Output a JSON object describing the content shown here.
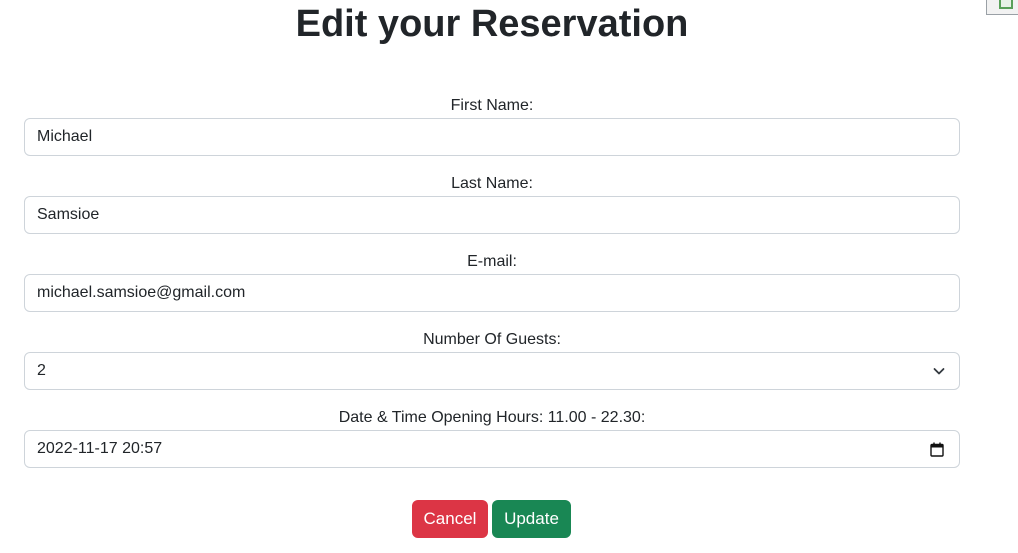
{
  "page": {
    "title": "Edit your Reservation"
  },
  "form": {
    "first_name": {
      "label": "First Name:",
      "value": "Michael"
    },
    "last_name": {
      "label": "Last Name:",
      "value": "Samsioe"
    },
    "email": {
      "label": "E-mail:",
      "value": "michael.samsioe@gmail.com"
    },
    "guests": {
      "label": "Number Of Guests:",
      "value": "2",
      "icon": "chevron-down-icon"
    },
    "datetime": {
      "label": "Date & Time Opening Hours: 11.00 - 22.30:",
      "value": "2022-11-17 20:57",
      "icon": "calendar-icon"
    }
  },
  "actions": {
    "cancel_label": "Cancel",
    "update_label": "Update"
  },
  "colors": {
    "cancel": "#dc3545",
    "update": "#198754",
    "input_border": "#ced4da",
    "text": "#212529"
  }
}
